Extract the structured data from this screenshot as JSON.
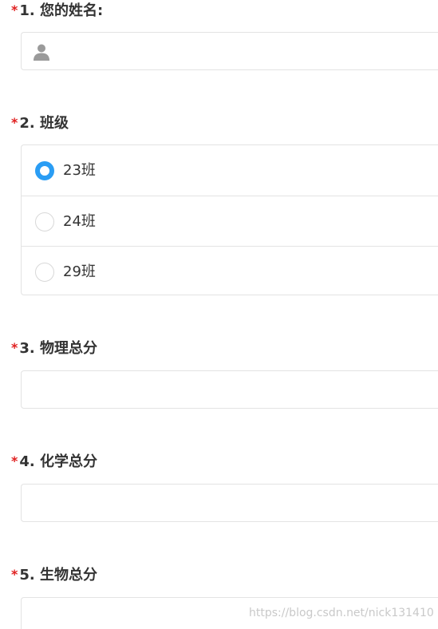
{
  "required_mark": "*",
  "questions": [
    {
      "title": "1. 您的姓名:",
      "type": "text",
      "icon": "user-icon",
      "value": ""
    },
    {
      "title": "2. 班级",
      "type": "radio",
      "options": [
        {
          "label": "23班",
          "checked": true
        },
        {
          "label": "24班",
          "checked": false
        },
        {
          "label": "29班",
          "checked": false
        }
      ]
    },
    {
      "title": "3. 物理总分",
      "type": "text",
      "value": ""
    },
    {
      "title": "4. 化学总分",
      "type": "text",
      "value": ""
    },
    {
      "title": "5. 生物总分",
      "type": "text",
      "value": ""
    }
  ],
  "colors": {
    "required": "#e02020",
    "radio_checked": "#2a9df4",
    "border": "#e3e3e3"
  },
  "watermark": "https://blog.csdn.net/nick131410"
}
